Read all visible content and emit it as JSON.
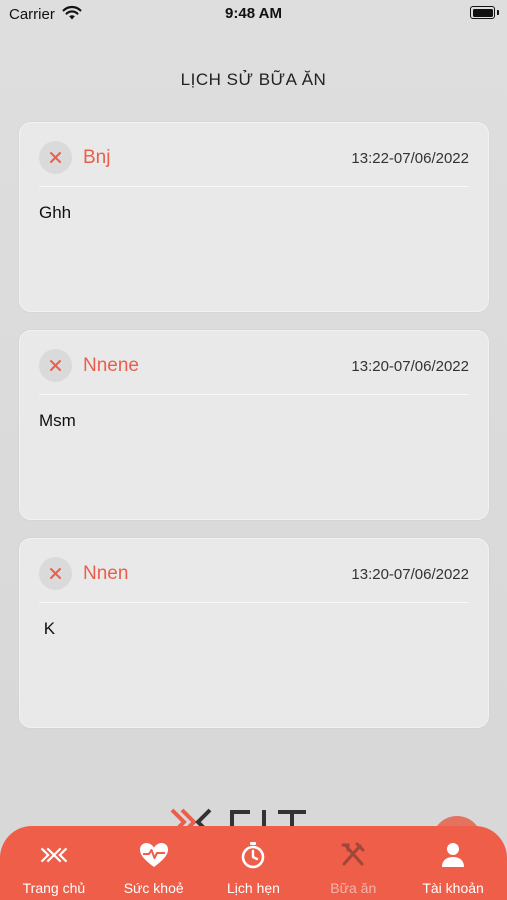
{
  "status_bar": {
    "carrier": "Carrier",
    "time": "9:48 AM"
  },
  "page": {
    "title": "LỊCH SỬ BỮA ĂN"
  },
  "meals": [
    {
      "name": "Bnj",
      "datetime": "13:22-07/06/2022",
      "note": "Ghh"
    },
    {
      "name": "Nnene",
      "datetime": "13:20-07/06/2022",
      "note": "Msm"
    },
    {
      "name": "Nnen",
      "datetime": "13:20-07/06/2022",
      "note": " K"
    }
  ],
  "tab_bar": {
    "items": [
      {
        "label": "Trang chủ",
        "icon": "home-chevrons-icon",
        "active": true
      },
      {
        "label": "Sức khoẻ",
        "icon": "heart-pulse-icon",
        "active": true
      },
      {
        "label": "Lịch hẹn",
        "icon": "stopwatch-icon",
        "active": true
      },
      {
        "label": "Bữa ăn",
        "icon": "fork-knife-icon",
        "active": false
      },
      {
        "label": "Tài khoản",
        "icon": "user-icon",
        "active": true
      }
    ]
  },
  "colors": {
    "accent": "#ee5e49",
    "name_text": "#e8604c",
    "card_bg": "#e9e9e9"
  }
}
